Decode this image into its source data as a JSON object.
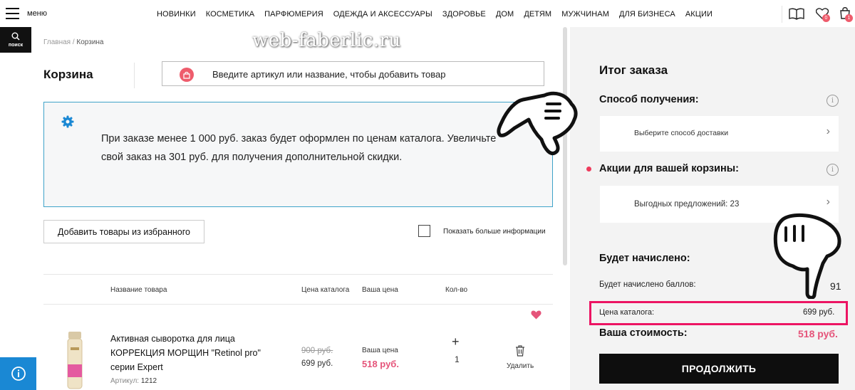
{
  "header": {
    "menu_label": "меню",
    "nav": [
      "НОВИНКИ",
      "КОСМЕТИКА",
      "ПАРФЮМЕРИЯ",
      "ОДЕЖДА И АКСЕССУАРЫ",
      "ЗДОРОВЬЕ",
      "ДОМ",
      "ДЕТЯМ",
      "МУЖЧИНАМ",
      "ДЛЯ БИЗНЕСА",
      "АКЦИИ"
    ],
    "favorites_count": "0",
    "cart_count": "1",
    "search_label": "поиск"
  },
  "breadcrumb": {
    "home": "Главная",
    "sep": "/",
    "current": "Корзина"
  },
  "watermark": "web-faberlic.ru",
  "cart": {
    "title": "Корзина",
    "add_placeholder": "Введите артикул или название, чтобы добавить товар",
    "notice": "При заказе менее 1 000 руб. заказ будет оформлен по ценам каталога. Увеличьте свой заказ на 301 руб. для получения дополнительной скидки.",
    "add_favorites": "Добавить товары из избранного",
    "show_more_info": "Показать больше информации",
    "columns": {
      "name": "Название товара",
      "catalog_price": "Цена каталога",
      "your_price": "Ваша цена",
      "qty": "Кол-во"
    },
    "items": [
      {
        "name": "Активная сыворотка для лица КОРРЕКЦИЯ МОРЩИН \"Retinol pro\" серии Expert",
        "article_label": "Артикул:",
        "article": "1212",
        "old_price": "900 руб.",
        "catalog_price": "699 руб.",
        "your_price_label": "Ваша цена",
        "your_price": "518 руб.",
        "qty": "1",
        "plus": "+",
        "delete_label": "Удалить"
      }
    ]
  },
  "summary": {
    "title": "Итог заказа",
    "delivery_title": "Способ получения:",
    "delivery_choice": "Выберите способ доставки",
    "promo_title": "Акции для вашей корзины:",
    "promo_offers": "Выгодных предложений: 23",
    "accrual_title": "Будет начислено:",
    "points_label": "Будет начислено баллов:",
    "points_value": "91",
    "catalog_price_label": "Цена каталога:",
    "catalog_price_value": "699 руб.",
    "total_label": "Ваша стоимость:",
    "total_value": "518 руб.",
    "continue": "ПРОДОЛЖИТЬ"
  },
  "colors": {
    "accent_pink": "#e5547a",
    "highlight": "#ec1463",
    "notice_border": "#3fa3c9",
    "info_blue": "#1a88d4"
  }
}
